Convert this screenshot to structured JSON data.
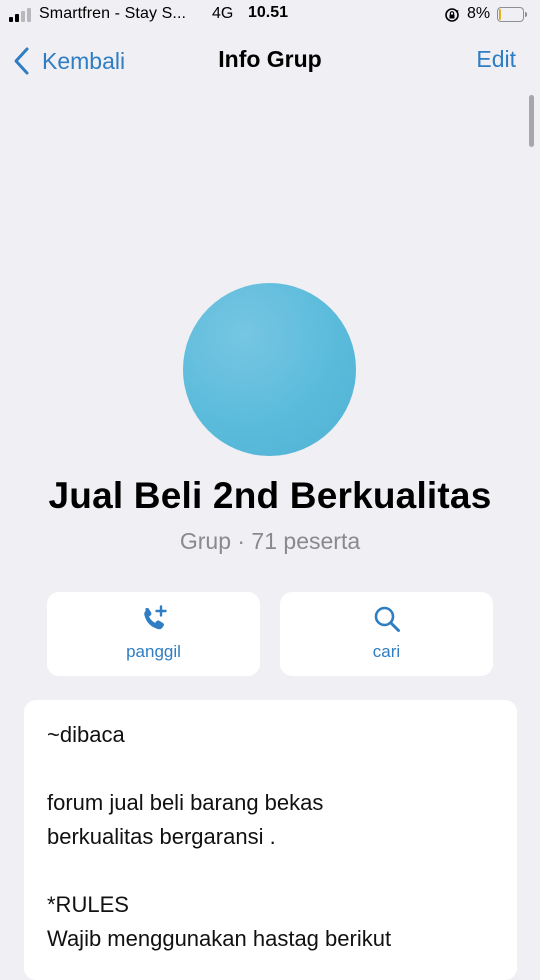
{
  "status_bar": {
    "carrier": "Smartfren - Stay S...",
    "network": "4G",
    "time": "10.51",
    "battery_percent": "8%",
    "battery_level": 0.08,
    "signal_bars_active": 2,
    "signal_bars_total": 4
  },
  "nav": {
    "back_label": "Kembali",
    "title": "Info Grup",
    "edit_label": "Edit",
    "accent_color": "#2f7dc2"
  },
  "group": {
    "name": "Jual Beli 2nd Berkualitas",
    "meta": "Grup · 71 peserta",
    "avatar_color": "#5bbbdb"
  },
  "actions": {
    "call_label": "panggil",
    "search_label": "cari",
    "call_icon": "phone-plus-icon",
    "search_icon": "search-icon"
  },
  "description": {
    "lines": [
      "~dibaca",
      "",
      "forum jual beli barang bekas",
      "berkualitas bergaransi .",
      "",
      "*RULES",
      "Wajib menggunakan hastag berikut"
    ]
  }
}
